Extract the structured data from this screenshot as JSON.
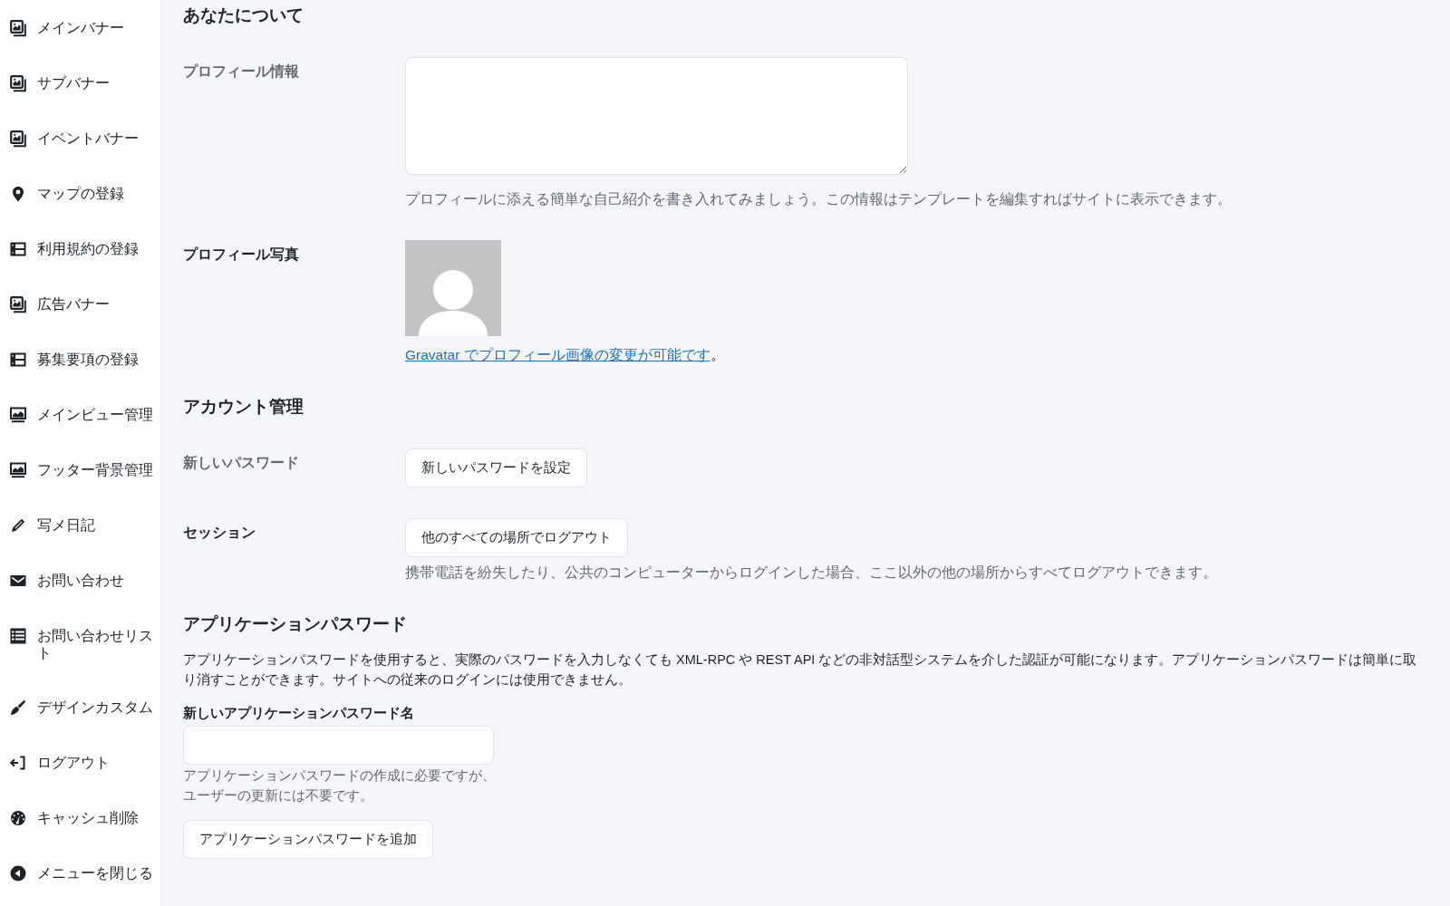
{
  "sidebar": {
    "items": [
      {
        "label": "メインバナー",
        "kind": "images"
      },
      {
        "label": "サブバナー",
        "kind": "images"
      },
      {
        "label": "イベントバナー",
        "kind": "images"
      },
      {
        "label": "マップの登録",
        "kind": "pin"
      },
      {
        "label": "利用規約の登録",
        "kind": "table"
      },
      {
        "label": "広告バナー",
        "kind": "images"
      },
      {
        "label": "募集要項の登録",
        "kind": "table"
      },
      {
        "label": "メインビュー管理",
        "kind": "monitor"
      },
      {
        "label": "フッター背景管理",
        "kind": "monitor"
      },
      {
        "label": "写メ日記",
        "kind": "pencil"
      },
      {
        "label": "お問い合わせ",
        "kind": "mail"
      },
      {
        "label": "お問い合わせリスト",
        "kind": "list"
      },
      {
        "label": "デザインカスタム",
        "kind": "brush"
      },
      {
        "label": "ログアウト",
        "kind": "logout"
      },
      {
        "label": "キャッシュ削除",
        "kind": "gauge"
      },
      {
        "label": "メニューを閉じる",
        "kind": "collapse"
      }
    ]
  },
  "sections": [
    {
      "heading": "あなたについて",
      "rows": [
        {
          "kind": "textarea",
          "label": "プロフィール情報",
          "muted": true,
          "description": "プロフィールに添える簡単な自己紹介を書き入れてみましょう。この情報はテンプレートを編集すればサイトに表示できます。"
        },
        {
          "kind": "avatar",
          "label": "プロフィール写真",
          "muted": false,
          "link": "Gravatar でプロフィール画像の変更が可能です",
          "suffix": "。"
        }
      ]
    },
    {
      "heading": "アカウント管理",
      "rows": [
        {
          "kind": "button",
          "label": "新しいパスワード",
          "muted": true,
          "button": "新しいパスワードを設定"
        },
        {
          "kind": "button",
          "label": "セッション",
          "muted": false,
          "button": "他のすべての場所でログアウト",
          "description": "携帯電話を紛失したり、公共のコンピューターからログインした場合、ここ以外の他の場所からすべてログアウトできます。"
        }
      ]
    }
  ],
  "application_passwords": {
    "heading": "アプリケーションパスワード",
    "intro": "アプリケーションパスワードを使用すると、実際のパスワードを入力しなくても XML-RPC や REST API などの非対話型システムを介した認証が可能になります。アプリケーションパスワードは簡単に取り消すことができます。サイトへの従来のログインには使用できません。",
    "name_field": {
      "label": "新しいアプリケーションパスワード名",
      "description": "アプリケーションパスワードの作成に必要ですが、ユーザーの更新には不要です。"
    },
    "add_button": "アプリケーションパスワードを追加"
  }
}
